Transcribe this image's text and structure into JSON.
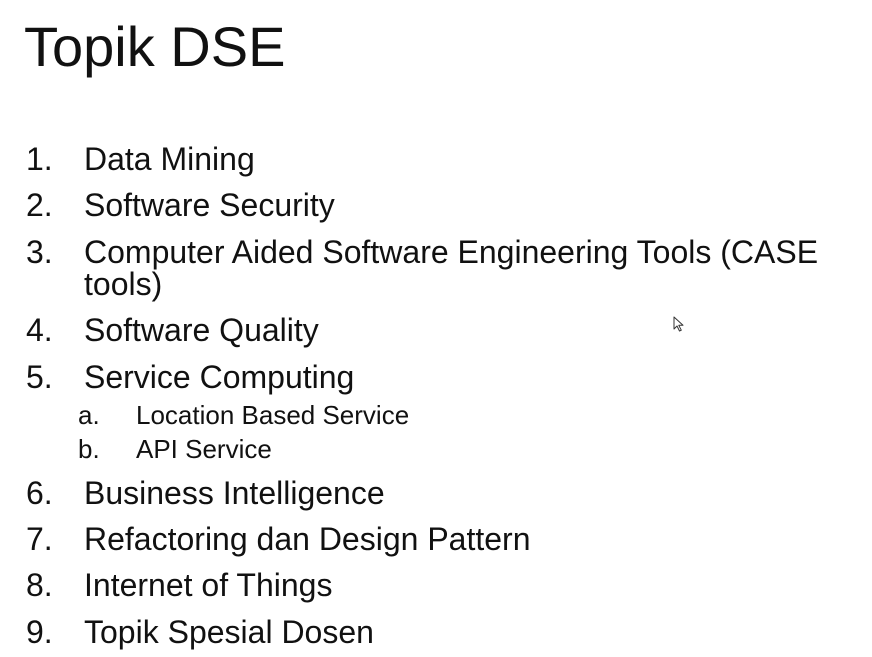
{
  "slide": {
    "title": "Topik DSE",
    "items": [
      {
        "num": "1.",
        "text": "Data Mining"
      },
      {
        "num": "2.",
        "text": "Software Security"
      },
      {
        "num": "3.",
        "text": "Computer Aided Software Engineering Tools (CASE tools)"
      },
      {
        "num": "4.",
        "text": "Software Quality"
      },
      {
        "num": "5.",
        "text": "Service Computing"
      },
      {
        "num": "6.",
        "text": "Business Intelligence"
      },
      {
        "num": "7.",
        "text": "Refactoring dan Design Pattern"
      },
      {
        "num": "8.",
        "text": "Internet of Things"
      },
      {
        "num": "9.",
        "text": "Topik Spesial Dosen"
      }
    ],
    "subitems": [
      {
        "num": "a.",
        "text": "Location Based Service"
      },
      {
        "num": "b.",
        "text": "API Service"
      }
    ]
  },
  "cursor": {
    "icon": "mouse-pointer-icon"
  }
}
